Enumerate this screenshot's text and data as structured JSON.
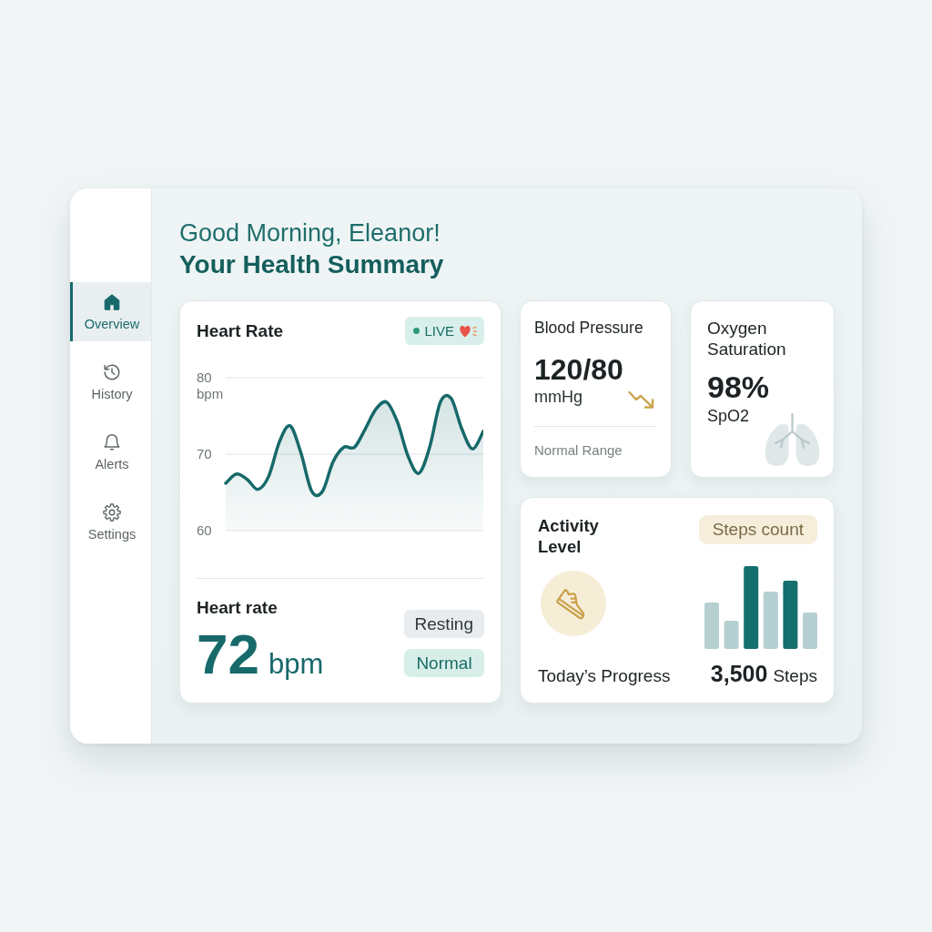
{
  "sidebar": {
    "items": [
      {
        "label": "Overview",
        "selected": true
      },
      {
        "label": "History",
        "selected": false
      },
      {
        "label": "Alerts",
        "selected": false
      },
      {
        "label": "Settings",
        "selected": false
      }
    ]
  },
  "header": {
    "greeting": "Good Morning, Eleanor!",
    "title": "Your Health Summary"
  },
  "heart_rate_card": {
    "title": "Heart Rate",
    "live_badge": "LIVE",
    "chart_data": {
      "type": "area",
      "ylabel": "bpm",
      "categories": [
        null,
        null,
        null,
        null,
        null,
        null,
        null,
        null,
        null,
        null,
        null,
        null,
        null,
        null,
        null,
        null,
        null,
        null,
        null,
        null,
        null,
        null,
        null,
        null,
        null
      ],
      "values": [
        66.2,
        67.4,
        66.7,
        65.4,
        67.1,
        71.6,
        73.7,
        70.2,
        65.2,
        65.1,
        69.0,
        70.9,
        70.9,
        73.3,
        75.9,
        76.8,
        74.2,
        69.7,
        67.5,
        70.9,
        76.8,
        77.3,
        73.3,
        70.7,
        73.0
      ],
      "ylim": [
        60,
        80
      ],
      "yticks": [
        60,
        70,
        80
      ]
    },
    "summary_label": "Heart rate",
    "value": "72",
    "unit": "bpm",
    "tags": [
      {
        "label": "Resting",
        "color": "#e8ecee"
      },
      {
        "label": "Normal",
        "color": "#d8efe9"
      }
    ]
  },
  "blood_pressure_card": {
    "title": "Blood Pressure",
    "value": "120/80",
    "unit": "mmHg",
    "note": "Normal Range"
  },
  "oxygen_card": {
    "title": "Oxygen Saturation",
    "value": "98%",
    "unit": "SpO2"
  },
  "activity_card": {
    "title": "Activity Level",
    "badge": "Steps count",
    "progress_label": "Today’s Progress",
    "steps_value": "3,500",
    "steps_unit": "Steps"
  }
}
